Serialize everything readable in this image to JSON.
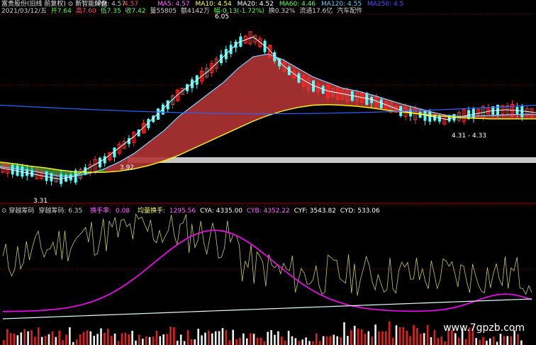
{
  "header": {
    "stock_name": "富贵股份(旧线 前复权)",
    "indicator_name": "新智能解盘",
    "pm_label": "PM: 4.57",
    "pm_value": "4.57",
    "ma5": "MA5: 4.57",
    "ma10": "MA10: 4.54",
    "ma20": "MA20: 4.52",
    "ma60": "MA60: 4.46",
    "ma120": "MA120: 4.55",
    "ma250": "MA250: 4.5"
  },
  "info_bar": {
    "date": "2021/03/12/五",
    "open": "开7.64",
    "high": "高7.60",
    "low": "低7.35",
    "close": "收7.42",
    "volume": "量55805",
    "amount": "额4142万",
    "change": "幅-0.13(-1.72%)",
    "turnover": "换0.32%",
    "float_cap": "流通17.6亿",
    "sector": "汽车配件"
  },
  "lower_panel": {
    "title": "穿越筹码",
    "cy_label": "穿越筹码: 6.35",
    "turnover_label": "换手率:",
    "turnover_val": "0.08",
    "vol_label": "均量换手:",
    "vol_val": "1295.56",
    "cya": "CYA: 4335.00",
    "cyb": "CYB: 4352.22",
    "cyf": "CYF: 3543.82",
    "cyd": "CYD: 533.06"
  },
  "annotations": {
    "peak": "6.05",
    "low1": "3.92",
    "low2": "3.31",
    "range": "4.31 - 4.33"
  },
  "watermark": "www.7gpzb.com",
  "colors": {
    "up": "#ff3232",
    "down": "#54ffff",
    "ma_white": "#ffffff",
    "ma_yellow": "#ffff00",
    "ma_magenta": "#ff00ff",
    "ma_green": "#00e600",
    "ma_blue": "#3060ff",
    "cloud_red": "#b03434",
    "cloud_green": "#3c8c3c",
    "bg": "#000000",
    "grid": "#7a0000"
  },
  "chart_data": {
    "type": "line",
    "title": "",
    "xlabel": "",
    "ylabel": "",
    "ylim": [
      3.0,
      6.3
    ],
    "series": [
      {
        "name": "MA5",
        "values": [
          3.6,
          3.55,
          3.5,
          3.45,
          3.4,
          3.45,
          3.6,
          3.75,
          3.95,
          4.15,
          4.4,
          4.65,
          4.9,
          5.1,
          5.3,
          5.55,
          5.8,
          5.9,
          5.7,
          5.4,
          5.2,
          5.05,
          4.95,
          4.9,
          4.85,
          4.8,
          4.7,
          4.6,
          4.55,
          4.5,
          4.45,
          4.5,
          4.55,
          4.6,
          4.62,
          4.6,
          4.57
        ]
      },
      {
        "name": "MA10",
        "values": [
          3.62,
          3.58,
          3.55,
          3.5,
          3.45,
          3.45,
          3.5,
          3.58,
          3.7,
          3.85,
          4.05,
          4.25,
          4.5,
          4.7,
          4.9,
          5.1,
          5.35,
          5.55,
          5.6,
          5.5,
          5.35,
          5.2,
          5.1,
          5.0,
          4.95,
          4.88,
          4.8,
          4.72,
          4.65,
          4.58,
          4.52,
          4.5,
          4.51,
          4.52,
          4.53,
          4.54,
          4.54
        ]
      },
      {
        "name": "MA60",
        "values": [
          3.7,
          3.67,
          3.63,
          3.6,
          3.56,
          3.53,
          3.52,
          3.52,
          3.54,
          3.58,
          3.64,
          3.72,
          3.82,
          3.94,
          4.06,
          4.18,
          4.3,
          4.42,
          4.52,
          4.6,
          4.66,
          4.7,
          4.71,
          4.7,
          4.68,
          4.65,
          4.61,
          4.58,
          4.55,
          4.52,
          4.5,
          4.48,
          4.47,
          4.46,
          4.46,
          4.46,
          4.46
        ]
      }
    ]
  }
}
